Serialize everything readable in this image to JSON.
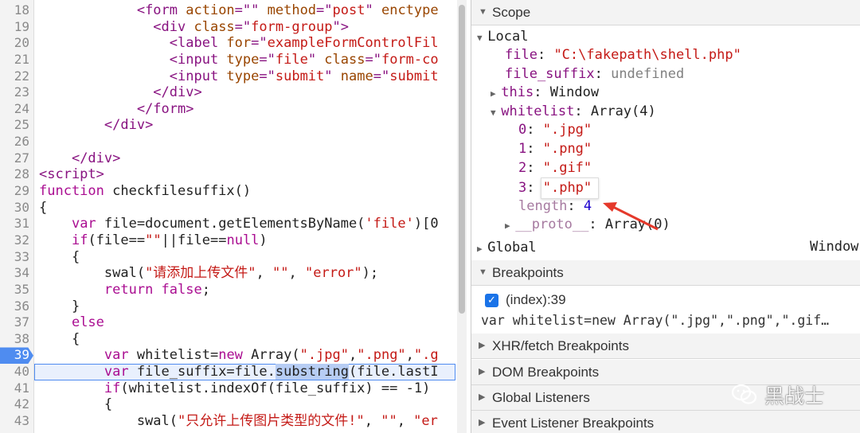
{
  "editor": {
    "lines": [
      {
        "n": "18",
        "tokens": [
          [
            "plain",
            "            "
          ],
          [
            "tag",
            "<form "
          ],
          [
            "attr",
            "action"
          ],
          [
            "tag",
            "=\"\" "
          ],
          [
            "attr",
            "method"
          ],
          [
            "tag",
            "=\""
          ],
          [
            "str",
            "post"
          ],
          [
            "tag",
            "\" "
          ],
          [
            "attr",
            "enctype"
          ]
        ]
      },
      {
        "n": "19",
        "tokens": [
          [
            "plain",
            "              "
          ],
          [
            "tag",
            "<div "
          ],
          [
            "attr",
            "class"
          ],
          [
            "tag",
            "=\""
          ],
          [
            "str",
            "form-group"
          ],
          [
            "tag",
            "\">"
          ]
        ]
      },
      {
        "n": "20",
        "tokens": [
          [
            "plain",
            "                "
          ],
          [
            "tag",
            "<label "
          ],
          [
            "attr",
            "for"
          ],
          [
            "tag",
            "=\""
          ],
          [
            "str",
            "exampleFormControlFil"
          ]
        ]
      },
      {
        "n": "21",
        "tokens": [
          [
            "plain",
            "                "
          ],
          [
            "tag",
            "<input "
          ],
          [
            "attr",
            "type"
          ],
          [
            "tag",
            "=\""
          ],
          [
            "str",
            "file"
          ],
          [
            "tag",
            "\" "
          ],
          [
            "attr",
            "class"
          ],
          [
            "tag",
            "=\""
          ],
          [
            "str",
            "form-co"
          ]
        ]
      },
      {
        "n": "22",
        "tokens": [
          [
            "plain",
            "                "
          ],
          [
            "tag",
            "<input "
          ],
          [
            "attr",
            "type"
          ],
          [
            "tag",
            "=\""
          ],
          [
            "str",
            "submit"
          ],
          [
            "tag",
            "\" "
          ],
          [
            "attr",
            "name"
          ],
          [
            "tag",
            "=\""
          ],
          [
            "str",
            "submit"
          ]
        ]
      },
      {
        "n": "23",
        "tokens": [
          [
            "plain",
            "              "
          ],
          [
            "tag",
            "</div>"
          ]
        ]
      },
      {
        "n": "24",
        "tokens": [
          [
            "plain",
            "            "
          ],
          [
            "tag",
            "</form>"
          ]
        ]
      },
      {
        "n": "25",
        "tokens": [
          [
            "plain",
            "        "
          ],
          [
            "tag",
            "</div>"
          ]
        ]
      },
      {
        "n": "26",
        "tokens": []
      },
      {
        "n": "27",
        "tokens": [
          [
            "plain",
            "    "
          ],
          [
            "tag",
            "</div>"
          ]
        ]
      },
      {
        "n": "28",
        "tokens": [
          [
            "tag",
            "<script>"
          ]
        ]
      },
      {
        "n": "29",
        "tokens": [
          [
            "kw",
            "function "
          ],
          [
            "plain",
            "checkfilesuffix()"
          ]
        ]
      },
      {
        "n": "30",
        "tokens": [
          [
            "plain",
            "{"
          ]
        ]
      },
      {
        "n": "31",
        "tokens": [
          [
            "plain",
            "    "
          ],
          [
            "kw",
            "var "
          ],
          [
            "plain",
            "file=document.getElementsByName("
          ],
          [
            "str",
            "'file'"
          ],
          [
            "plain",
            ")[0"
          ]
        ]
      },
      {
        "n": "32",
        "tokens": [
          [
            "plain",
            "    "
          ],
          [
            "kw",
            "if"
          ],
          [
            "plain",
            "(file=="
          ],
          [
            "str",
            "\"\""
          ],
          [
            "plain",
            "||file=="
          ],
          [
            "kw",
            "null"
          ],
          [
            "plain",
            ")"
          ]
        ]
      },
      {
        "n": "33",
        "tokens": [
          [
            "plain",
            "    {"
          ]
        ]
      },
      {
        "n": "34",
        "tokens": [
          [
            "plain",
            "        swal("
          ],
          [
            "str",
            "\"请添加上传文件\""
          ],
          [
            "plain",
            ", "
          ],
          [
            "str",
            "\"\""
          ],
          [
            "plain",
            ", "
          ],
          [
            "str",
            "\"error\""
          ],
          [
            "plain",
            ");"
          ]
        ]
      },
      {
        "n": "35",
        "tokens": [
          [
            "plain",
            "        "
          ],
          [
            "kw",
            "return false"
          ],
          [
            "plain",
            ";"
          ]
        ]
      },
      {
        "n": "36",
        "tokens": [
          [
            "plain",
            "    }"
          ]
        ]
      },
      {
        "n": "37",
        "tokens": [
          [
            "plain",
            "    "
          ],
          [
            "kw",
            "else"
          ]
        ]
      },
      {
        "n": "38",
        "tokens": [
          [
            "plain",
            "    {"
          ]
        ]
      },
      {
        "n": "39",
        "bp": true,
        "tokens": [
          [
            "plain",
            "        "
          ],
          [
            "kw",
            "var "
          ],
          [
            "plain",
            "whitelist="
          ],
          [
            "kw",
            "new "
          ],
          [
            "plain",
            "Array("
          ],
          [
            "str",
            "\".jpg\""
          ],
          [
            "plain",
            ","
          ],
          [
            "str",
            "\".png\""
          ],
          [
            "plain",
            ","
          ],
          [
            "str",
            "\".g"
          ]
        ]
      },
      {
        "n": "40",
        "paused": true,
        "tokens": [
          [
            "plain",
            "        "
          ],
          [
            "kw",
            "var "
          ],
          [
            "plain",
            "file_suffix=file."
          ],
          [
            "hl",
            "substring"
          ],
          [
            "plain",
            "(file.lastI"
          ]
        ]
      },
      {
        "n": "41",
        "tokens": [
          [
            "plain",
            "        "
          ],
          [
            "kw",
            "if"
          ],
          [
            "plain",
            "(whitelist.indexOf(file_suffix) == -1)"
          ]
        ]
      },
      {
        "n": "42",
        "tokens": [
          [
            "plain",
            "        {"
          ]
        ]
      },
      {
        "n": "43",
        "tokens": [
          [
            "plain",
            "            swal("
          ],
          [
            "str",
            "\"只允许上传图片类型的文件!\""
          ],
          [
            "plain",
            ", "
          ],
          [
            "str",
            "\"\""
          ],
          [
            "plain",
            ", "
          ],
          [
            "str",
            "\"er"
          ]
        ]
      }
    ]
  },
  "scope": {
    "header": "Scope",
    "local_label": "Local",
    "file_key": "file",
    "file_value": "\"C:\\fakepath\\shell.php\"",
    "file_suffix_key": "file_suffix",
    "file_suffix_value": "undefined",
    "this_key": "this",
    "this_value": "Window",
    "whitelist_key": "whitelist",
    "whitelist_value": "Array(4)",
    "items": [
      {
        "idx": "0",
        "val": "\".jpg\""
      },
      {
        "idx": "1",
        "val": "\".png\""
      },
      {
        "idx": "2",
        "val": "\".gif\""
      },
      {
        "idx": "3",
        "val": "\".php\""
      }
    ],
    "length_key": "length",
    "length_value": "4",
    "proto_key": "__proto__",
    "proto_value": "Array(0)",
    "global_label": "Global",
    "global_value": "Window"
  },
  "breakpoints": {
    "header": "Breakpoints",
    "item_label": "(index):39",
    "item_code": "var whitelist=new Array(\".jpg\",\".png\",\".gif…"
  },
  "sections": [
    "XHR/fetch Breakpoints",
    "DOM Breakpoints",
    "Global Listeners",
    "Event Listener Breakpoints"
  ],
  "watermark": "黑战士",
  "colors": {
    "accent": "#4f8cf0",
    "arrow": "#e5392b"
  }
}
